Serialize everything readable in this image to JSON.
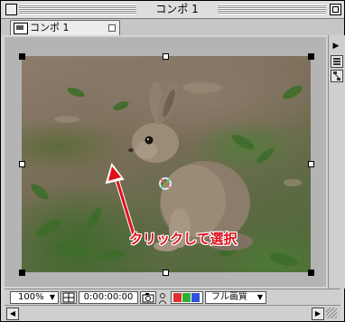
{
  "window": {
    "title": "コンポ 1"
  },
  "tab": {
    "label": "コンポ 1"
  },
  "side_panel": {
    "menu_arrow": "▶"
  },
  "composition": {
    "selection_target": "anchor-point-icon"
  },
  "annotation": {
    "text": "クリックして選択",
    "color": "#e0101a"
  },
  "bottom_bar": {
    "zoom": "100%",
    "timecode": "0:00:00:00",
    "resolution": "フル画質",
    "color_channels": [
      "#e03030",
      "#30b030",
      "#3050e0"
    ]
  }
}
